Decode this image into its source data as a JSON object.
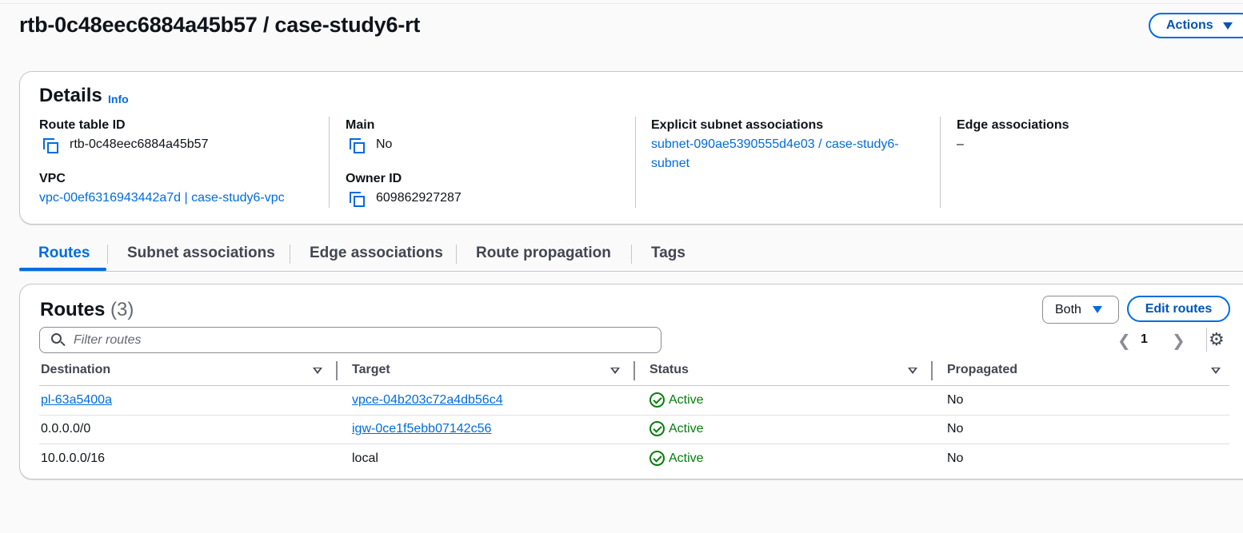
{
  "page": {
    "title": "rtb-0c48eec6884a45b57 / case-study6-rt",
    "actions_label": "Actions"
  },
  "details": {
    "heading": "Details",
    "info_label": "Info",
    "route_table_id_label": "Route table ID",
    "route_table_id": "rtb-0c48eec6884a45b57",
    "vpc_label": "VPC",
    "vpc_value": "vpc-00ef6316943442a7d | case-study6-vpc",
    "main_label": "Main",
    "main_value": "No",
    "owner_id_label": "Owner ID",
    "owner_id": "609862927287",
    "explicit_subnet_label": "Explicit subnet associations",
    "explicit_subnet_line1": "subnet-090ae5390555d4e03 / case-study6-",
    "explicit_subnet_line2": "subnet",
    "edge_assoc_label": "Edge associations",
    "edge_assoc_value": "–"
  },
  "tabs": [
    {
      "label": "Routes",
      "active": true
    },
    {
      "label": "Subnet associations",
      "active": false
    },
    {
      "label": "Edge associations",
      "active": false
    },
    {
      "label": "Route propagation",
      "active": false
    },
    {
      "label": "Tags",
      "active": false
    }
  ],
  "routes": {
    "title": "Routes",
    "count": "(3)",
    "filter_select": "Both",
    "edit_label": "Edit routes",
    "search_placeholder": "Filter routes",
    "page": "1",
    "columns": [
      "Destination",
      "Target",
      "Status",
      "Propagated"
    ],
    "rows": [
      {
        "destination": "pl-63a5400a",
        "target": "vpce-04b203c72a4db56c4",
        "status": "Active",
        "propagated": "No"
      },
      {
        "destination": "0.0.0.0/0",
        "target": "igw-0ce1f5ebb07142c56",
        "status": "Active",
        "propagated": "No"
      },
      {
        "destination": "10.0.0.0/16",
        "target": "local",
        "status": "Active",
        "propagated": "No"
      }
    ]
  },
  "colors": {
    "link": "#006ce0",
    "success": "#037f0c",
    "border": "#c6c6cd"
  },
  "icons": [
    "copy-icon",
    "search-icon",
    "gear-icon",
    "chevron-left-icon",
    "chevron-right-icon",
    "caret-down-icon",
    "status-check-icon",
    "sort-icon"
  ]
}
